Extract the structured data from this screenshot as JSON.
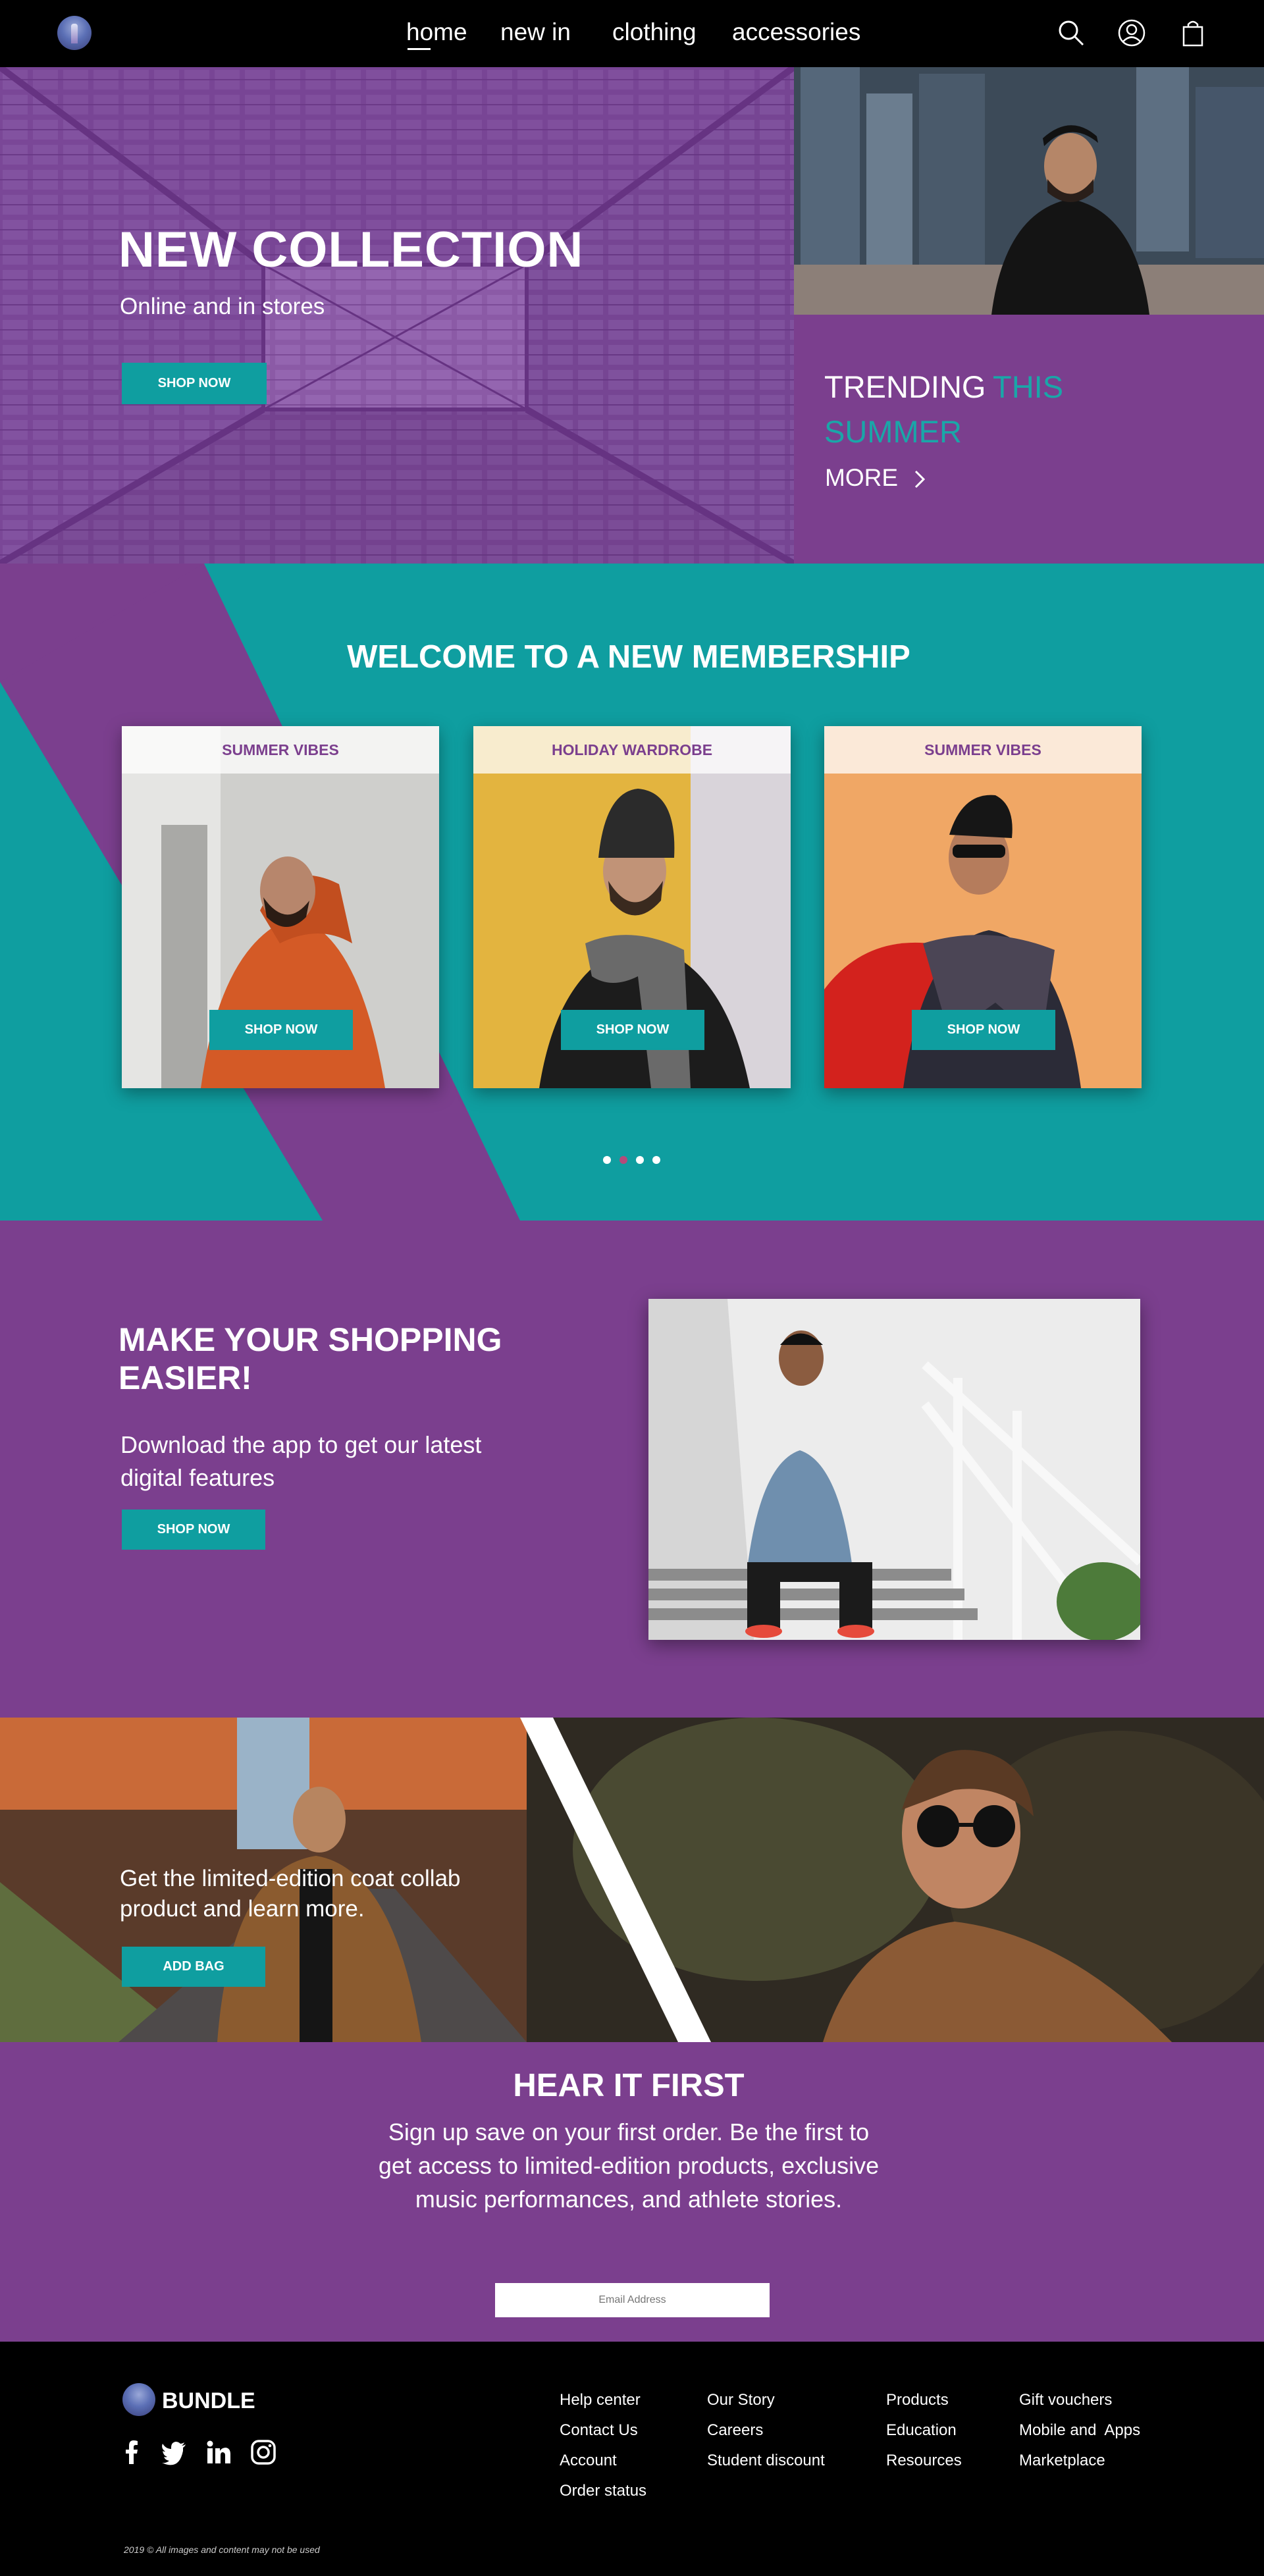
{
  "nav": {
    "links": [
      "home",
      "new in",
      "clothing",
      "accessories"
    ]
  },
  "hero": {
    "title": "NEW COLLECTION",
    "subtitle": "Online and in stores",
    "button": "SHOP NOW",
    "trending_white": "TRENDING",
    "trending_teal_1": "THIS",
    "trending_teal_2": "SUMMER",
    "more": "MORE"
  },
  "membership": {
    "title": "WELCOME TO A NEW MEMBERSHIP",
    "cards": [
      {
        "label": "SUMMER VIBES",
        "button": "SHOP NOW"
      },
      {
        "label": "HOLIDAY WARDROBE",
        "button": "SHOP NOW"
      },
      {
        "label": "SUMMER VIBES",
        "button": "SHOP NOW"
      }
    ],
    "active_dot": 2
  },
  "app": {
    "title": "MAKE YOUR SHOPPING EASIER!",
    "description": "Download the app to get our latest digital features",
    "button": "SHOP NOW"
  },
  "coat": {
    "text": "Get the limited-edition coat collab product and learn more.",
    "button": "ADD BAG"
  },
  "newsletter": {
    "title": "HEAR IT FIRST",
    "body": "Sign up save on your first order. Be the first to get access to limited-edition products, exclusive music performances, and athlete stories.",
    "email_placeholder": "Email Address"
  },
  "footer": {
    "brand": "BUNDLE",
    "col1": [
      "Help center",
      "Contact Us",
      "Account",
      "Order status"
    ],
    "col2": [
      "Our Story",
      "Careers",
      "Student discount"
    ],
    "col3": [
      "Products",
      "Education",
      "Resources"
    ],
    "col4": [
      "Gift vouchers",
      "Mobile and  Apps",
      "Marketplace"
    ],
    "copyright": "2019 © All images and content may not be used"
  },
  "colors": {
    "purple": "#7b3f8e",
    "teal": "#0f9ea0"
  }
}
